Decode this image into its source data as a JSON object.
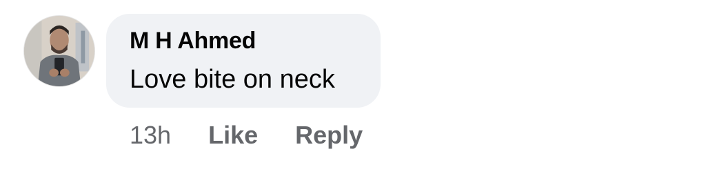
{
  "comment": {
    "author": "M H Ahmed",
    "text": "Love bite on neck",
    "timestamp": "13h",
    "like_label": "Like",
    "reply_label": "Reply"
  },
  "colors": {
    "bubble_background": "#f0f2f5",
    "primary_text": "#050505",
    "secondary_text": "#65676b"
  }
}
